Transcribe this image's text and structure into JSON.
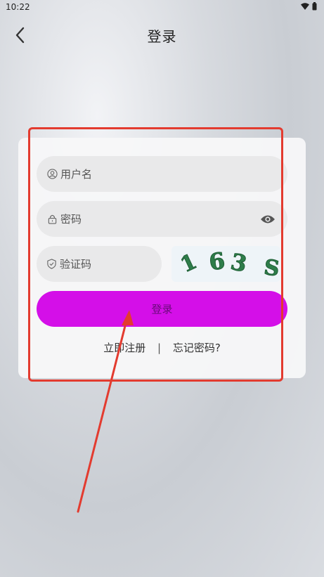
{
  "status_bar": {
    "time": "10:22"
  },
  "header": {
    "title": "登录"
  },
  "form": {
    "username_placeholder": "用户名",
    "password_placeholder": "密码",
    "captcha_placeholder": "验证码",
    "captcha_image_text": [
      "1",
      "6",
      "3",
      "S"
    ],
    "login_label": "登录",
    "register_link": "立即注册",
    "separator": "|",
    "forgot_link": "忘记密码?"
  },
  "colors": {
    "login_button": "#d40fe8",
    "captcha_text": "#2e7d4a",
    "annotation": "#e33b2f"
  }
}
